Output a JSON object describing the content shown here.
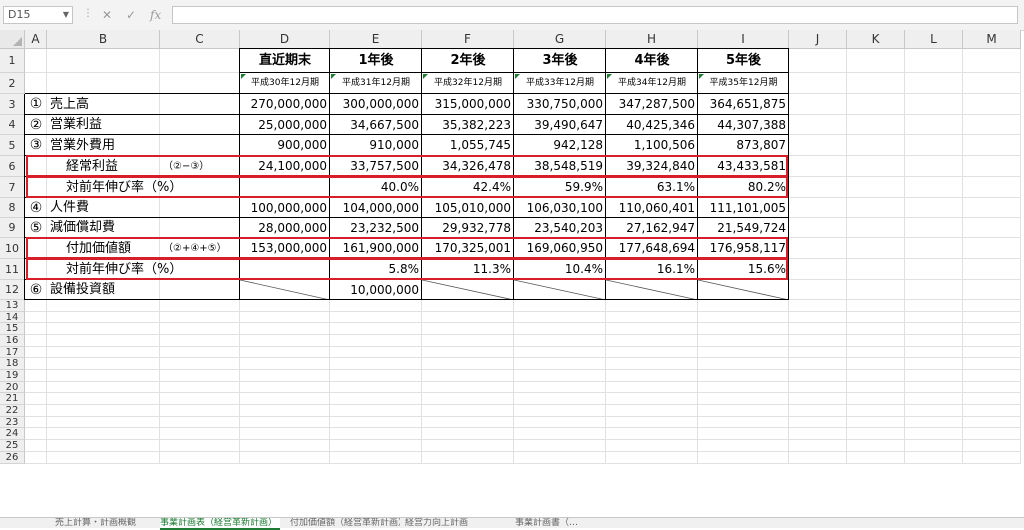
{
  "formula_bar": {
    "name_box": "D15",
    "cancel_glyph": "✕",
    "enter_glyph": "✓",
    "fx_label": "fx",
    "formula": ""
  },
  "columns": [
    "A",
    "B",
    "C",
    "D",
    "E",
    "F",
    "G",
    "H",
    "I",
    "J",
    "K",
    "L",
    "M"
  ],
  "rows": [
    "1",
    "2",
    "3",
    "4",
    "5",
    "6",
    "7",
    "8",
    "9",
    "10",
    "11",
    "12",
    "13",
    "14",
    "15",
    "16",
    "17",
    "18",
    "19",
    "20",
    "21",
    "22",
    "23",
    "24",
    "25",
    "26"
  ],
  "header": {
    "periods": [
      "直近期末",
      "1年後",
      "2年後",
      "3年後",
      "4年後",
      "5年後"
    ],
    "dates": [
      "平成30年12月期",
      "平成31年12月期",
      "平成32年12月期",
      "平成33年12月期",
      "平成34年12月期",
      "平成35年12月期"
    ]
  },
  "table": [
    {
      "marker": "①",
      "label": "売上高",
      "note": "",
      "values": [
        "270,000,000",
        "300,000,000",
        "315,000,000",
        "330,750,000",
        "347,287,500",
        "364,651,875"
      ]
    },
    {
      "marker": "②",
      "label": "営業利益",
      "note": "",
      "values": [
        "25,000,000",
        "34,667,500",
        "35,382,223",
        "39,490,647",
        "40,425,346",
        "44,307,388"
      ]
    },
    {
      "marker": "③",
      "label": "営業外費用",
      "note": "",
      "values": [
        "900,000",
        "910,000",
        "1,055,745",
        "942,128",
        "1,100,506",
        "873,807"
      ]
    },
    {
      "marker": "",
      "label": "経常利益",
      "note": "（②−③）",
      "values": [
        "24,100,000",
        "33,757,500",
        "34,326,478",
        "38,548,519",
        "39,324,840",
        "43,433,581"
      ]
    },
    {
      "marker": "",
      "label": "対前年伸び率（%）",
      "note": "",
      "values": [
        "",
        "40.0%",
        "42.4%",
        "59.9%",
        "63.1%",
        "80.2%"
      ]
    },
    {
      "marker": "④",
      "label": "人件費",
      "note": "",
      "values": [
        "100,000,000",
        "104,000,000",
        "105,010,000",
        "106,030,100",
        "110,060,401",
        "111,101,005"
      ]
    },
    {
      "marker": "⑤",
      "label": "減価償却費",
      "note": "",
      "values": [
        "28,000,000",
        "23,232,500",
        "29,932,778",
        "23,540,203",
        "27,162,947",
        "21,549,724"
      ]
    },
    {
      "marker": "",
      "label": "付加価値額",
      "note": "（②+④+⑤）",
      "values": [
        "153,000,000",
        "161,900,000",
        "170,325,001",
        "169,060,950",
        "177,648,694",
        "176,958,117"
      ]
    },
    {
      "marker": "",
      "label": "対前年伸び率（%）",
      "note": "",
      "values": [
        "",
        "5.8%",
        "11.3%",
        "10.4%",
        "16.1%",
        "15.6%"
      ]
    },
    {
      "marker": "⑥",
      "label": "設備投資額",
      "note": "",
      "values": [
        "",
        "10,000,000",
        "",
        "",
        "",
        ""
      ]
    }
  ],
  "sheet_tabs": [
    {
      "label": "売上計算・計画概観",
      "active": false
    },
    {
      "label": "事業計画表（経営革新計画）",
      "active": true
    },
    {
      "label": "付加価値額（経営革新計画）",
      "active": false
    },
    {
      "label": "経営力向上計画",
      "active": false
    },
    {
      "label": "事業計画書（…",
      "active": false
    }
  ],
  "colors": {
    "highlight": "#d81e28",
    "accent": "#1e7b34"
  }
}
